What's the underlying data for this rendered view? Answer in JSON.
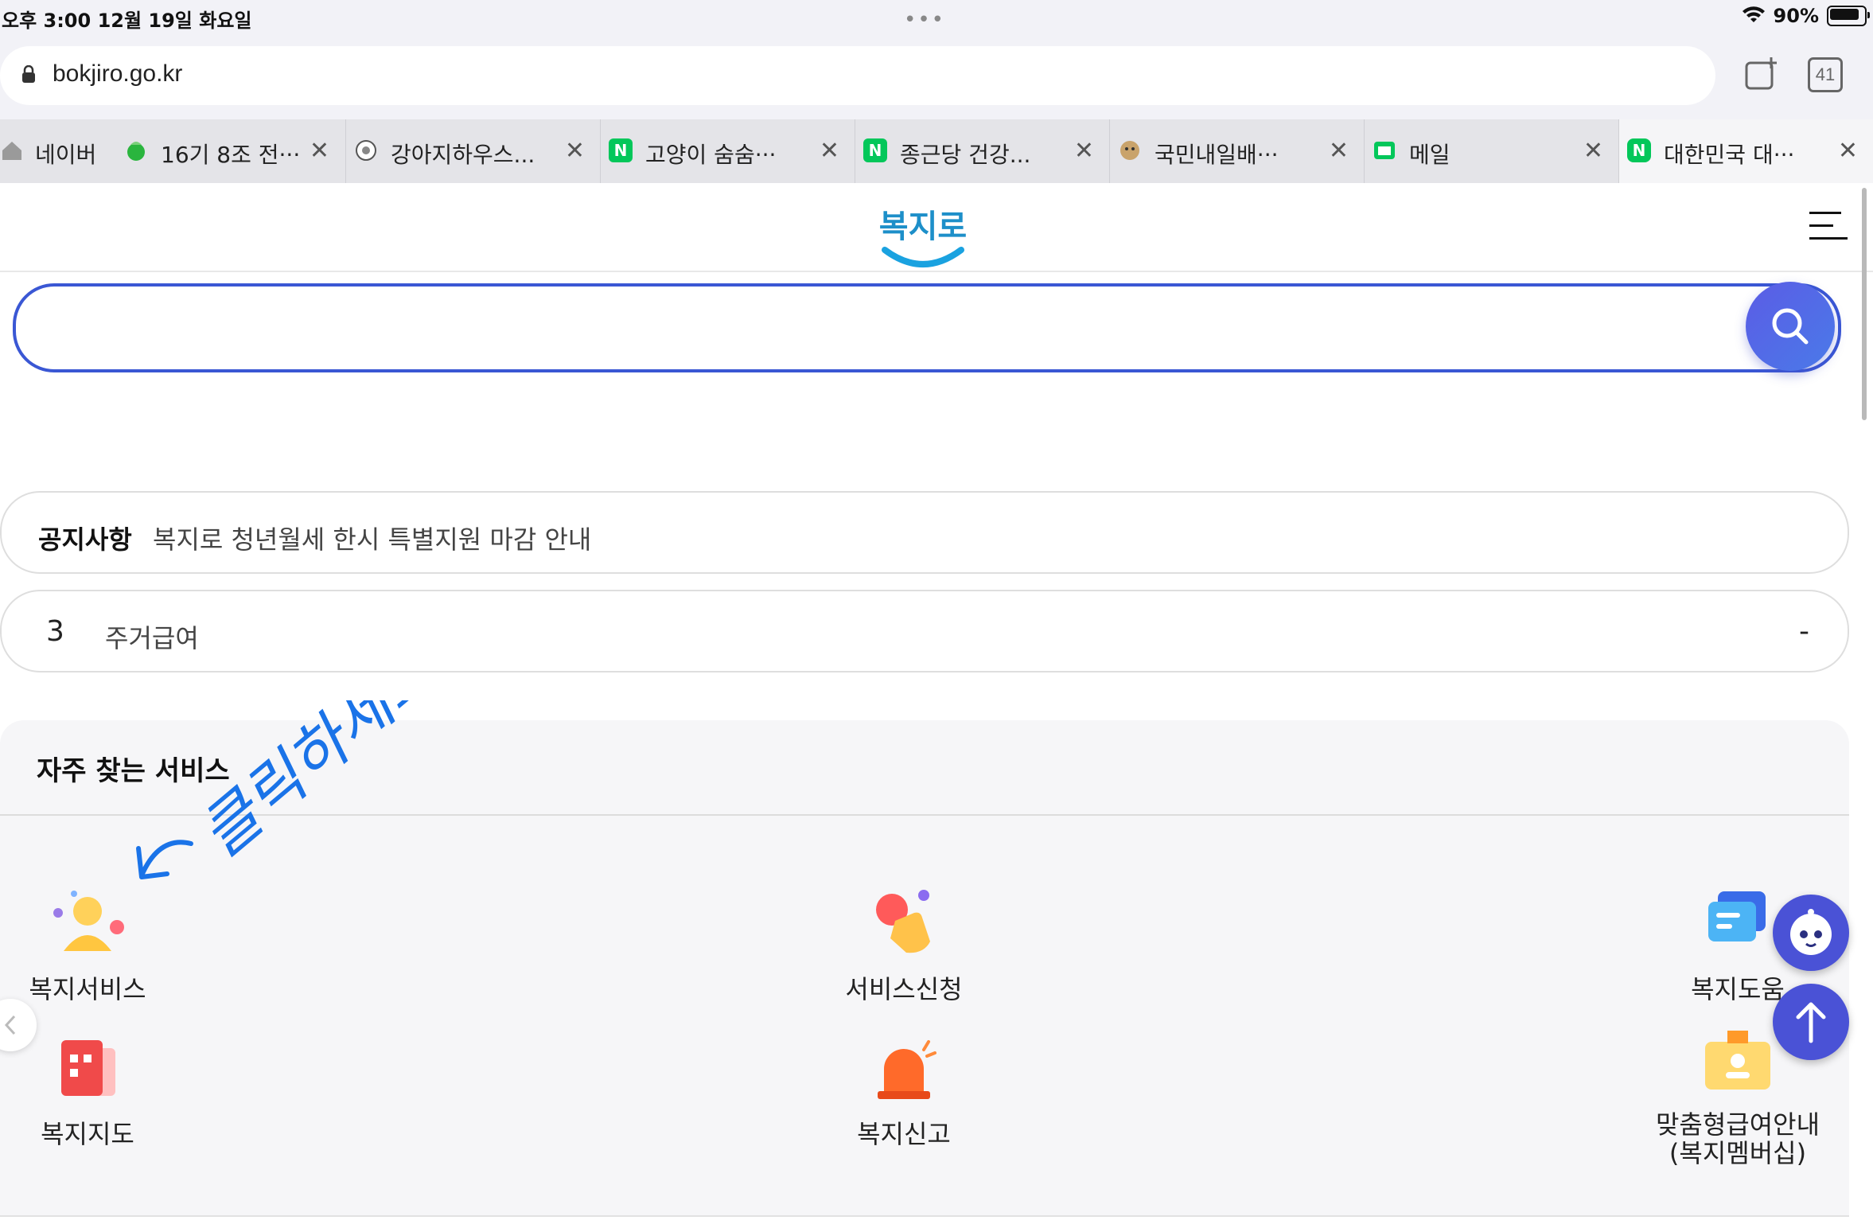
{
  "status_bar": {
    "time_date": "오후 3:00   12월 19일 화요일",
    "dots": "•••",
    "battery_percent": "90%"
  },
  "browser": {
    "url": "bokjiro.go.kr",
    "tab_count": "41",
    "tabs": [
      {
        "title": "네이버",
        "favicon": "home-icon"
      },
      {
        "title": "16기 8조 전···",
        "favicon": "cup-icon",
        "color": "#2ab53e"
      },
      {
        "title": "강아지하우스...",
        "favicon": "emblem-icon"
      },
      {
        "title": "고양이 숨숨···",
        "favicon": "naver-icon",
        "color": "#03c75a",
        "letter": "N"
      },
      {
        "title": "종근당 건강...",
        "favicon": "naver-icon",
        "color": "#03c75a",
        "letter": "N"
      },
      {
        "title": "국민내일배···",
        "favicon": "face-icon"
      },
      {
        "title": "메일",
        "favicon": "mail-icon",
        "color": "#03c75a"
      },
      {
        "title": "대한민국 대···",
        "favicon": "naver-icon",
        "color": "#03c75a",
        "letter": "N"
      }
    ]
  },
  "site": {
    "logo_text": "복지로",
    "accent_color": "#3a57d4"
  },
  "notice": {
    "label": "공지사항",
    "text": "복지로 청년월세 한시 특별지원 마감 안내"
  },
  "ranking": {
    "rank": "3",
    "keyword": "주거급여",
    "change": "-"
  },
  "services": {
    "title": "자주 찾는 서비스",
    "items": [
      {
        "label": "복지서비스",
        "icon": "person-icon"
      },
      {
        "label": "서비스신청",
        "icon": "hand-tap-icon"
      },
      {
        "label": "복지도움",
        "icon": "chat-icon"
      },
      {
        "label": "복지지도",
        "icon": "map-building-icon"
      },
      {
        "label": "복지신고",
        "icon": "siren-icon"
      },
      {
        "label": "맞춤형급여안내\n(복지멤버십)",
        "icon": "badge-icon"
      }
    ]
  },
  "annotation": {
    "handwritten_text": "클릭하세요"
  }
}
